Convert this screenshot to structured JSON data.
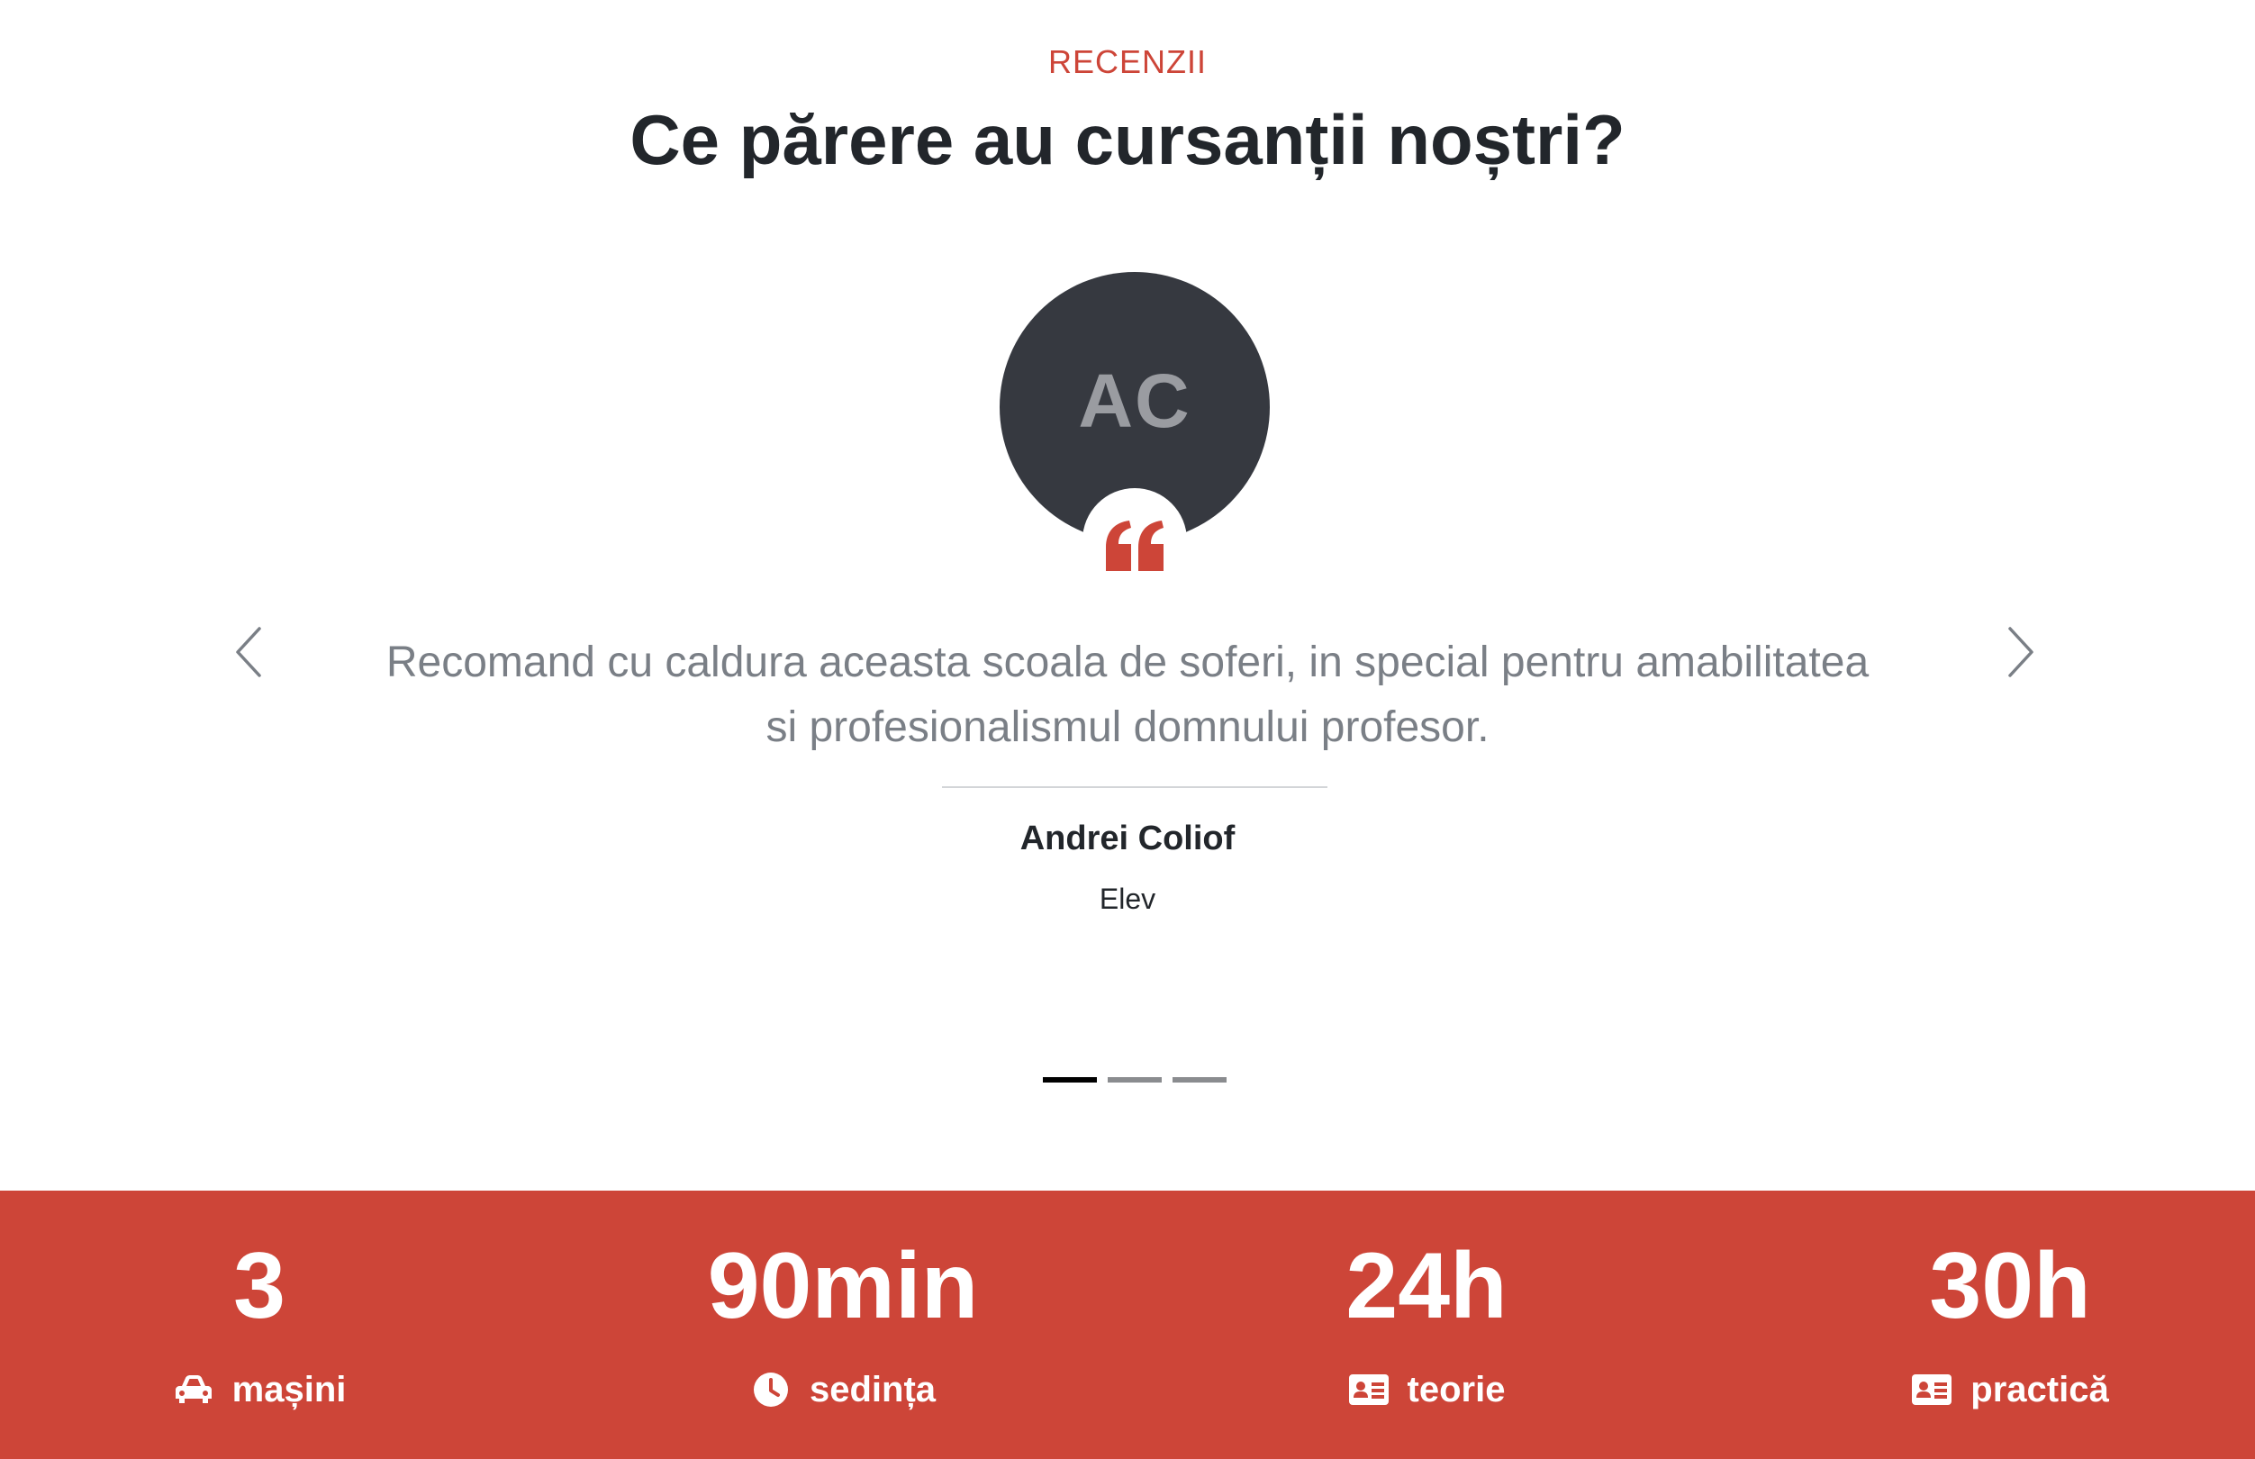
{
  "reviews": {
    "eyebrow": "RECENZII",
    "title": "Ce părere au cursanții noștri?",
    "avatar_initials": "AC",
    "quote_icon": "quote-icon",
    "text": "Recomand cu caldura aceasta scoala de soferi, in special pentru amabilitatea si profesionalismul domnului profesor.",
    "author_name": "Andrei Coliof",
    "author_role": "Elev",
    "prev_icon": "chevron-left-icon",
    "next_icon": "chevron-right-icon",
    "slides_count": 3,
    "active_slide": 1
  },
  "stats": [
    {
      "value": "3",
      "label": "mașini",
      "icon": "car-icon"
    },
    {
      "value": "90min",
      "label": "sedința",
      "icon": "clock-icon"
    },
    {
      "value": "24h",
      "label": "teorie",
      "icon": "id-card-icon"
    },
    {
      "value": "30h",
      "label": "practică",
      "icon": "id-card-icon"
    }
  ],
  "colors": {
    "accent": "#cd4538",
    "heading": "#22262b",
    "body_text": "#7a7f86",
    "avatar_bg": "#363940",
    "avatar_text": "#9a9ca1"
  }
}
